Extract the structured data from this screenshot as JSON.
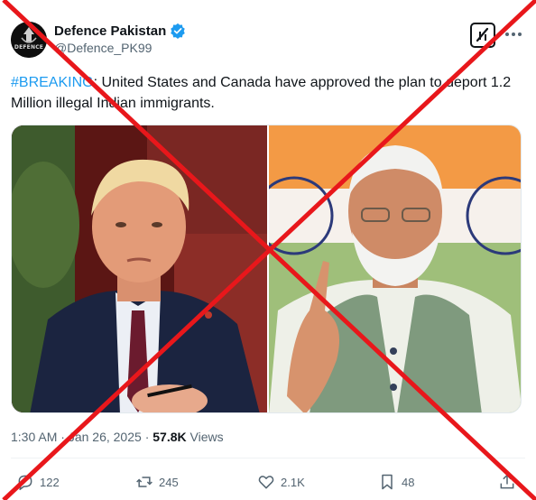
{
  "author": {
    "display_name": "Defence Pakistan",
    "handle": "@Defence_PK99",
    "avatar_text": "DEFENCE"
  },
  "tweet": {
    "hashtag": "#BREAKING",
    "text": ": United States and Canada have approved the plan to deport 1.2 Million illegal Indian immigrants."
  },
  "meta": {
    "time": "1:30 AM",
    "separator": "·",
    "date": "Jan 26, 2025",
    "views_count": "57.8K",
    "views_label": "Views"
  },
  "actions": {
    "replies": "122",
    "reposts": "245",
    "likes": "2.1K",
    "bookmarks": "48"
  },
  "colors": {
    "accent": "#1d9bf0",
    "strike": "#e8171b",
    "text_secondary": "#536471"
  },
  "icons": [
    "verified-badge-icon",
    "grok-icon",
    "more-icon",
    "reply-icon",
    "repost-icon",
    "like-icon",
    "bookmark-icon",
    "share-icon"
  ]
}
